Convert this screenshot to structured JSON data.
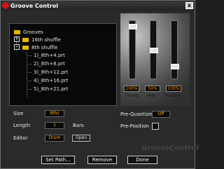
{
  "window": {
    "title": "Groove Control",
    "close_label": "x"
  },
  "tree": {
    "root": "Grooves",
    "items": [
      "16th shuffle",
      "8th shuffle",
      "1)_8th+4.prt",
      "2)_8th+8.prt",
      "3)_8th+12.prt",
      "4)_8th+16.prt",
      "5)_8th+21.prt"
    ]
  },
  "sliders": [
    {
      "label": "Timing",
      "value": "100%",
      "level": 0.95
    },
    {
      "label": "Velo",
      "value": "50%",
      "level": 0.48
    },
    {
      "label": "Position",
      "value": "100%",
      "level": 0.22
    }
  ],
  "fields": {
    "size_label": "Size",
    "size_value": "8ths",
    "length_label": "Length",
    "length_value": "1",
    "length_unit": "Bars",
    "editor_label": "Editor",
    "editor_value": "Drum",
    "open_button": "Open"
  },
  "right_panel": {
    "pre_quantize_label": "Pre-Quantize",
    "pre_quantize_value": "Off",
    "pre_position_label": "Pre-Position"
  },
  "buttons": {
    "set_path": "Set Path...",
    "remove": "Remove",
    "done": "Done"
  },
  "brand": "GrooveControl",
  "colors": {
    "accent": "#ffb000",
    "folder": "#e2b800"
  }
}
